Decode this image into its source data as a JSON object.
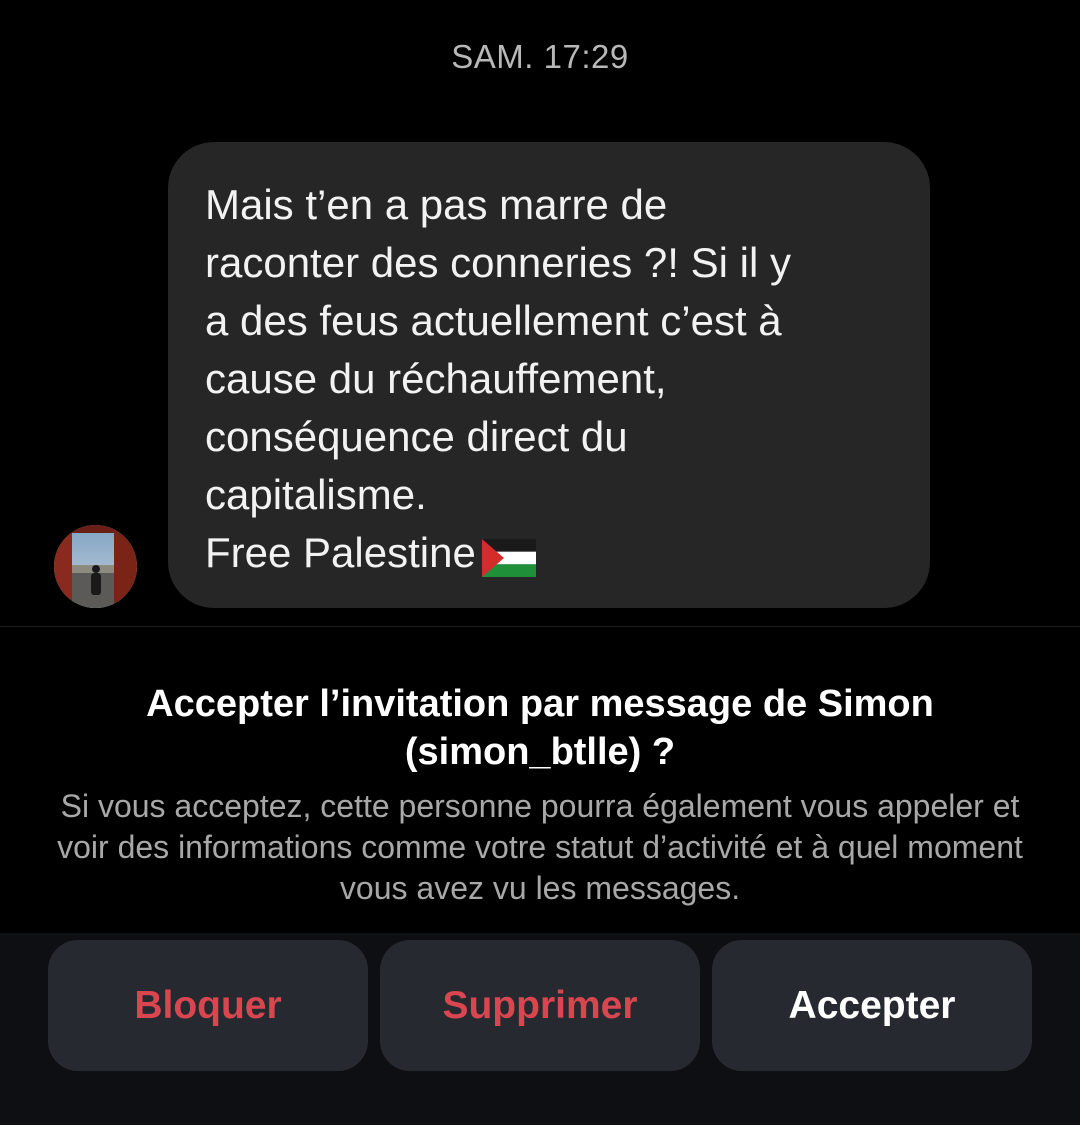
{
  "conversation": {
    "timestamp": "SAM. 17:29",
    "message": {
      "text": "Mais t’en a pas marre de\nraconter des conneries ?! Si il y\na des feus actuellement c’est à\ncause du réchauffement,\nconséquence direct du\ncapitalisme.\nFree Palestine",
      "emoji": "palestine-flag",
      "bubble_color": "#262626"
    }
  },
  "invitation": {
    "title": "Accepter l’invitation par message de Simon (simon_btlle) ?",
    "description": "Si vous acceptez, cette personne pourra également vous appeler et voir des informations comme votre statut d’activité et à quel moment vous avez vu les messages."
  },
  "actions": {
    "block_label": "Bloquer",
    "delete_label": "Supprimer",
    "accept_label": "Accepter",
    "destructive_color": "#d9464f"
  }
}
